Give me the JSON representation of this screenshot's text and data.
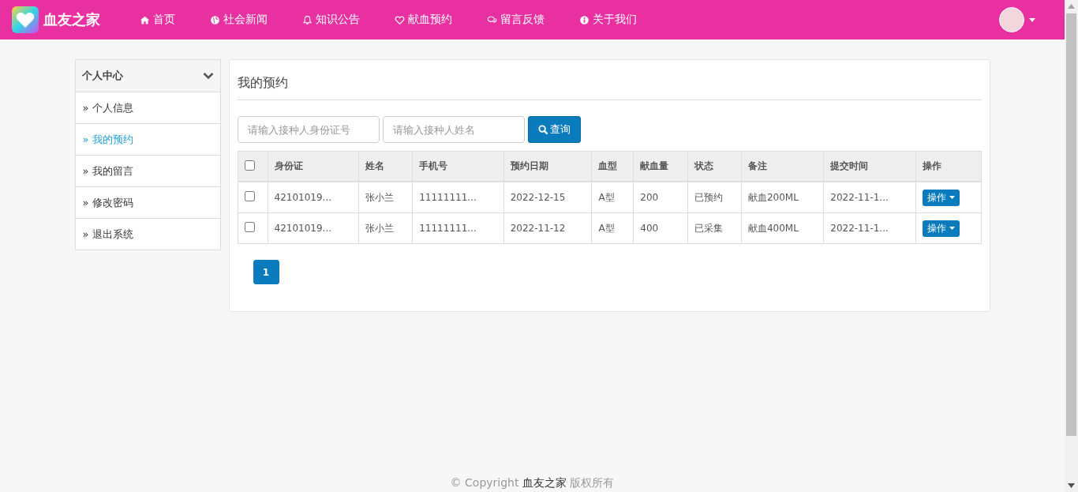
{
  "brand": "血友之家",
  "nav": [
    {
      "label": "首页"
    },
    {
      "label": "社会新闻"
    },
    {
      "label": "知识公告"
    },
    {
      "label": "献血预约"
    },
    {
      "label": "留言反馈"
    },
    {
      "label": "关于我们"
    }
  ],
  "sidebar": {
    "title": "个人中心",
    "items": [
      {
        "label": "» 个人信息",
        "selected": false
      },
      {
        "label": "» 我的预约",
        "selected": true
      },
      {
        "label": "» 我的留言",
        "selected": false
      },
      {
        "label": "» 修改密码",
        "selected": false
      },
      {
        "label": "» 退出系统",
        "selected": false
      }
    ]
  },
  "panel": {
    "title": "我的预约",
    "search": [
      {
        "placeholder": "请输入接种人身份证号"
      },
      {
        "placeholder": "请输入接种人姓名"
      }
    ],
    "search_button": "查询",
    "table": {
      "header_checked": false,
      "columns": [
        "身份证",
        "姓名",
        "手机号",
        "预约日期",
        "血型",
        "献血量",
        "状态",
        "备注",
        "提交时间",
        "操作"
      ],
      "rows": [
        {
          "checked": false,
          "cells": [
            "42101019...",
            "张小兰",
            "11111111...",
            "2022-12-15",
            "A型",
            "200",
            "已预约",
            "献血200ML",
            "2022-11-1..."
          ],
          "action": "操作"
        },
        {
          "checked": false,
          "cells": [
            "42101019...",
            "张小兰",
            "11111111...",
            "2022-11-12",
            "A型",
            "400",
            "已采集",
            "献血400ML",
            "2022-11-1..."
          ],
          "action": "操作"
        }
      ]
    },
    "pages": [
      {
        "label": "1",
        "selected": true
      }
    ]
  },
  "footer": {
    "prefix": "© Copyright",
    "site": "血友之家",
    "suffix": "版权所有"
  }
}
